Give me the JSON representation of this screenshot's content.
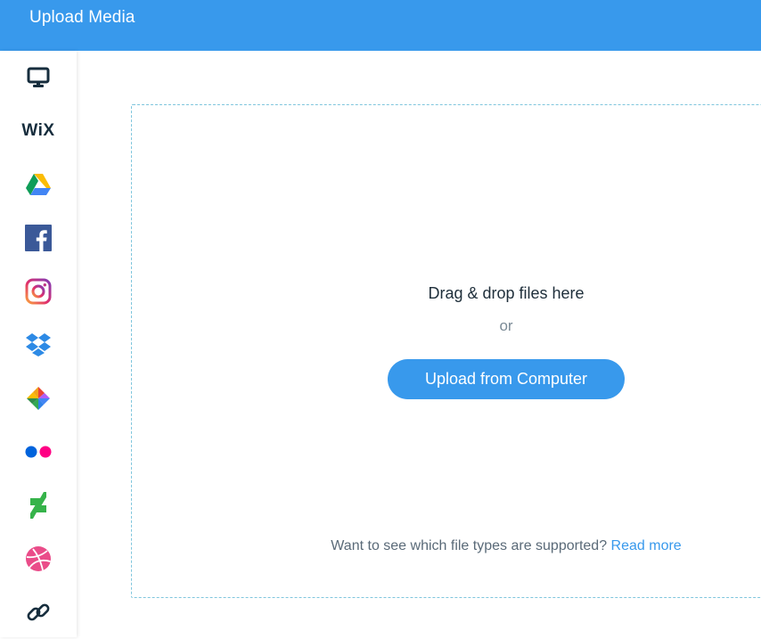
{
  "header": {
    "title": "Upload Media"
  },
  "sidebar": {
    "items": [
      {
        "name": "my-computer",
        "icon": "monitor-icon",
        "active": true
      },
      {
        "name": "wix",
        "icon": "wix-logo-icon",
        "label": "WiX"
      },
      {
        "name": "google-drive",
        "icon": "google-drive-icon"
      },
      {
        "name": "facebook",
        "icon": "facebook-icon"
      },
      {
        "name": "instagram",
        "icon": "instagram-icon"
      },
      {
        "name": "dropbox",
        "icon": "dropbox-icon"
      },
      {
        "name": "google-photos",
        "icon": "google-photos-icon"
      },
      {
        "name": "flickr",
        "icon": "flickr-icon"
      },
      {
        "name": "deviantart",
        "icon": "deviantart-icon"
      },
      {
        "name": "dribbble",
        "icon": "dribbble-icon"
      },
      {
        "name": "link",
        "icon": "link-icon"
      }
    ]
  },
  "dropzone": {
    "drag_label": "Drag & drop files here",
    "or_label": "or",
    "upload_button_label": "Upload from Computer",
    "support_text": "Want to see which file types are supported?",
    "read_more_label": "Read more"
  },
  "colors": {
    "accent": "#3899ec",
    "dashed_border": "#7fc6dd",
    "text_dark": "#20303c",
    "text_muted": "#5a6a78"
  }
}
